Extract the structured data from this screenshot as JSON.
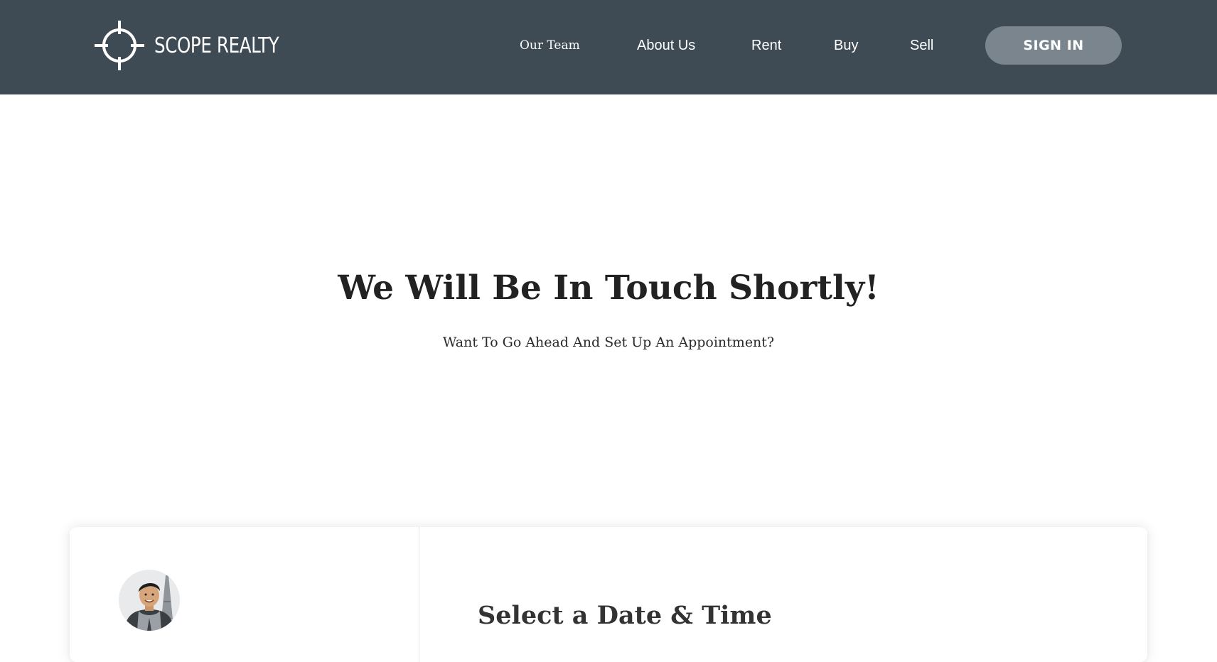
{
  "header": {
    "brand": "SCOPE REALTY",
    "background_color": "#3e4b55",
    "nav": [
      {
        "label": "Our Team"
      },
      {
        "label": "About Us"
      },
      {
        "label": "Rent"
      },
      {
        "label": "Buy"
      },
      {
        "label": "Sell"
      }
    ],
    "sign_in_label": "SIGN IN",
    "sign_in_color": "#7a858d"
  },
  "hero": {
    "title": "We Will Be In Touch Shortly!",
    "subtitle": "Want To Go Ahead And Set Up An Appointment?"
  },
  "scheduler": {
    "title": "Select a Date & Time"
  }
}
